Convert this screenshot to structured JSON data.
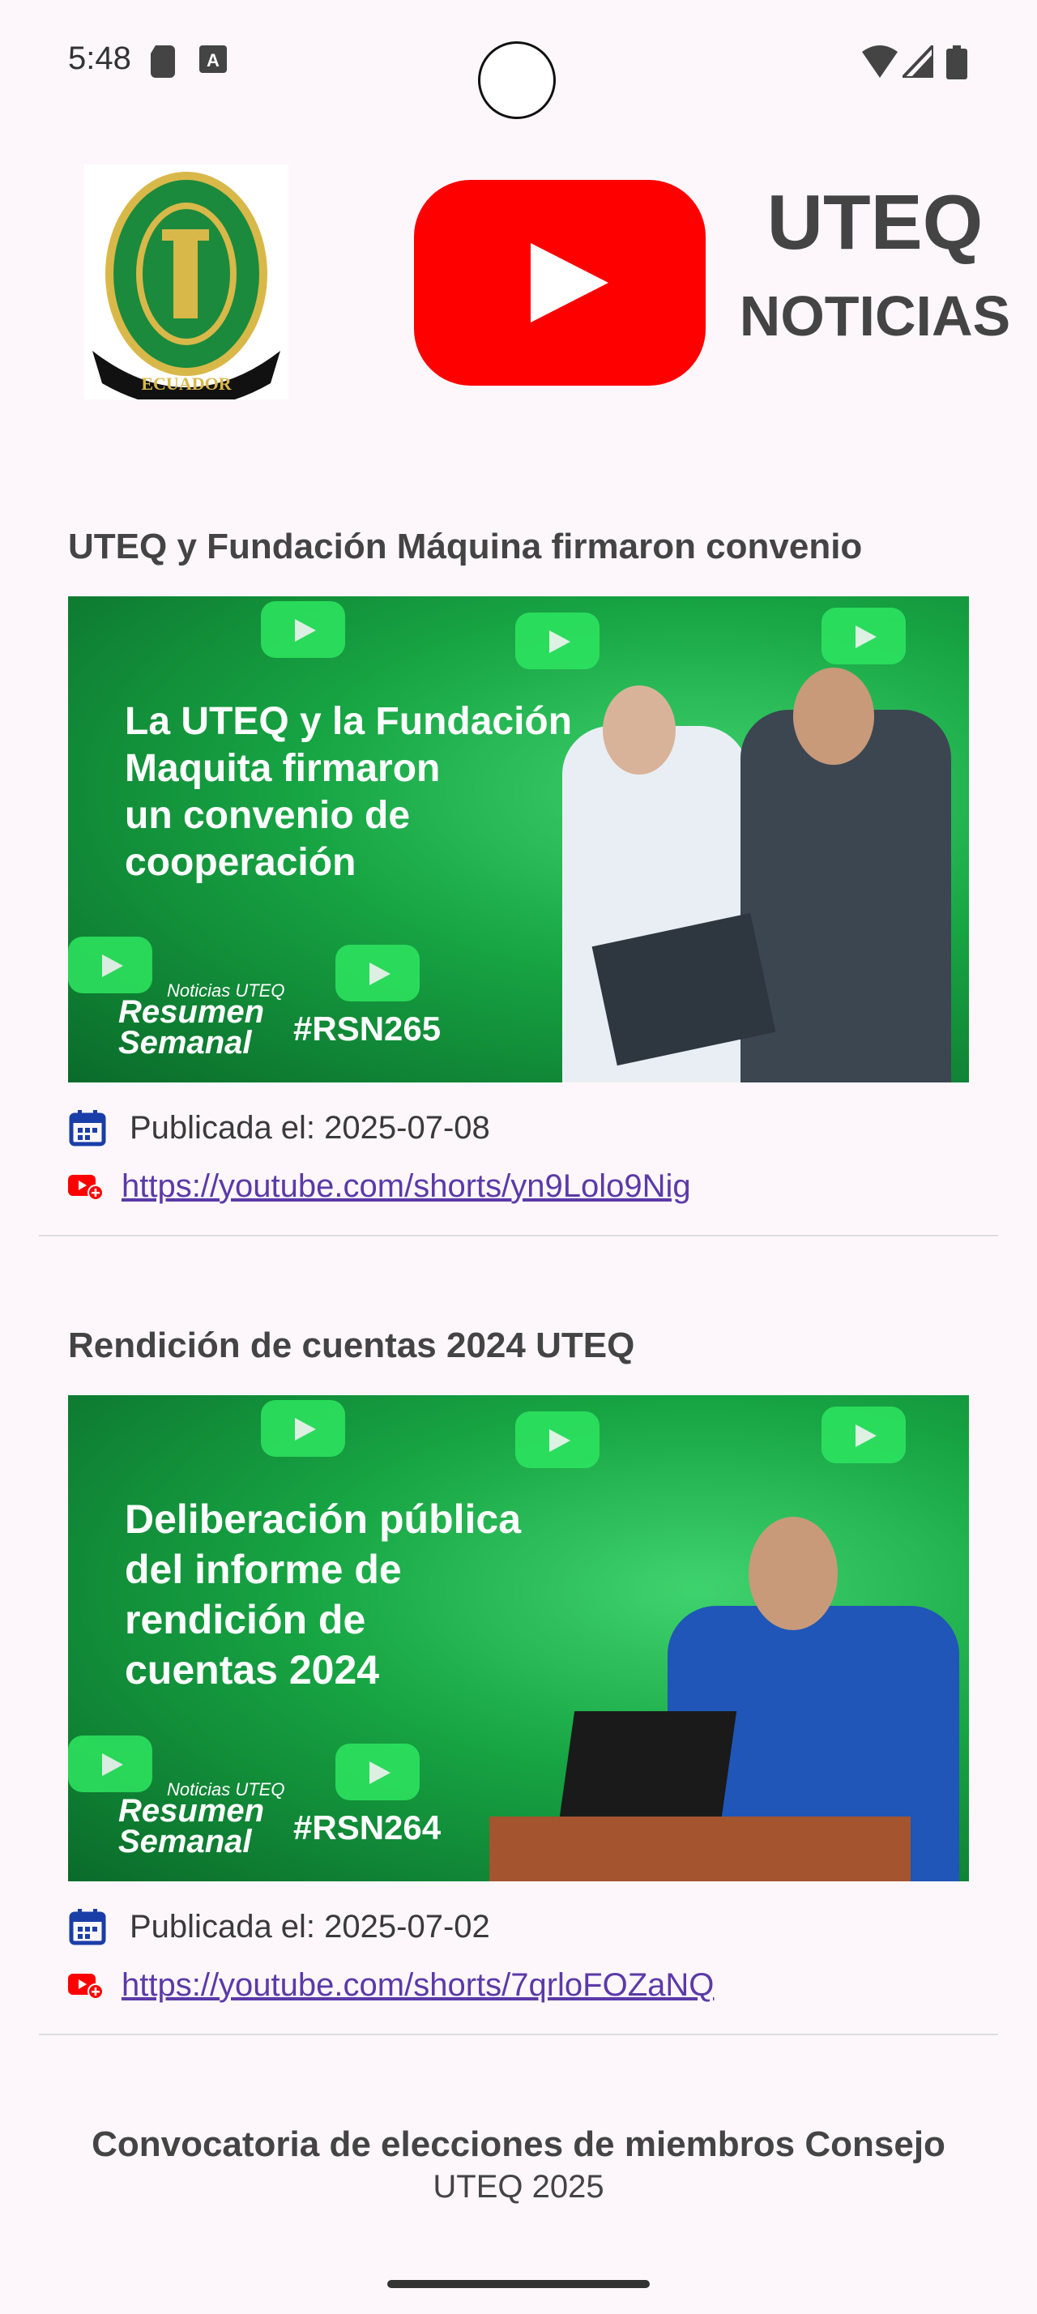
{
  "status_bar": {
    "time": "5:48"
  },
  "header": {
    "brand_title": "UTEQ",
    "brand_subtitle": "NOTICIAS"
  },
  "news": [
    {
      "title": "UTEQ y Fundación Máquina firmaron convenio",
      "thumbnail_lines": [
        "La UTEQ y la Fundación",
        "Maquita firmaron",
        "un convenio de",
        "cooperación"
      ],
      "thumbnail_small": "Noticias UTEQ",
      "thumbnail_big": "Resumen Semanal",
      "thumbnail_tag": "#RSN265",
      "date_text": "Publicada el: 2025-07-08",
      "link": "https://youtube.com/shorts/yn9Lolo9Nig"
    },
    {
      "title": "Rendición de cuentas 2024 UTEQ",
      "thumbnail_lines": [
        "Deliberación pública",
        "del informe de",
        "rendición de",
        "cuentas 2024"
      ],
      "thumbnail_small": "Noticias UTEQ",
      "thumbnail_big": "Resumen Semanal",
      "thumbnail_tag": "#RSN264",
      "date_text": "Publicada el: 2025-07-02",
      "link": "https://youtube.com/shorts/7qrloFOZaNQ"
    },
    {
      "title": "Convocatoria de elecciones de miembros Consejo",
      "title_line2": "UTEQ 2025"
    }
  ],
  "colors": {
    "youtube_red": "#ff0000",
    "link": "#5b3aa8",
    "calendar_blue": "#1a3ea8",
    "thumb_green": "#17a443"
  }
}
